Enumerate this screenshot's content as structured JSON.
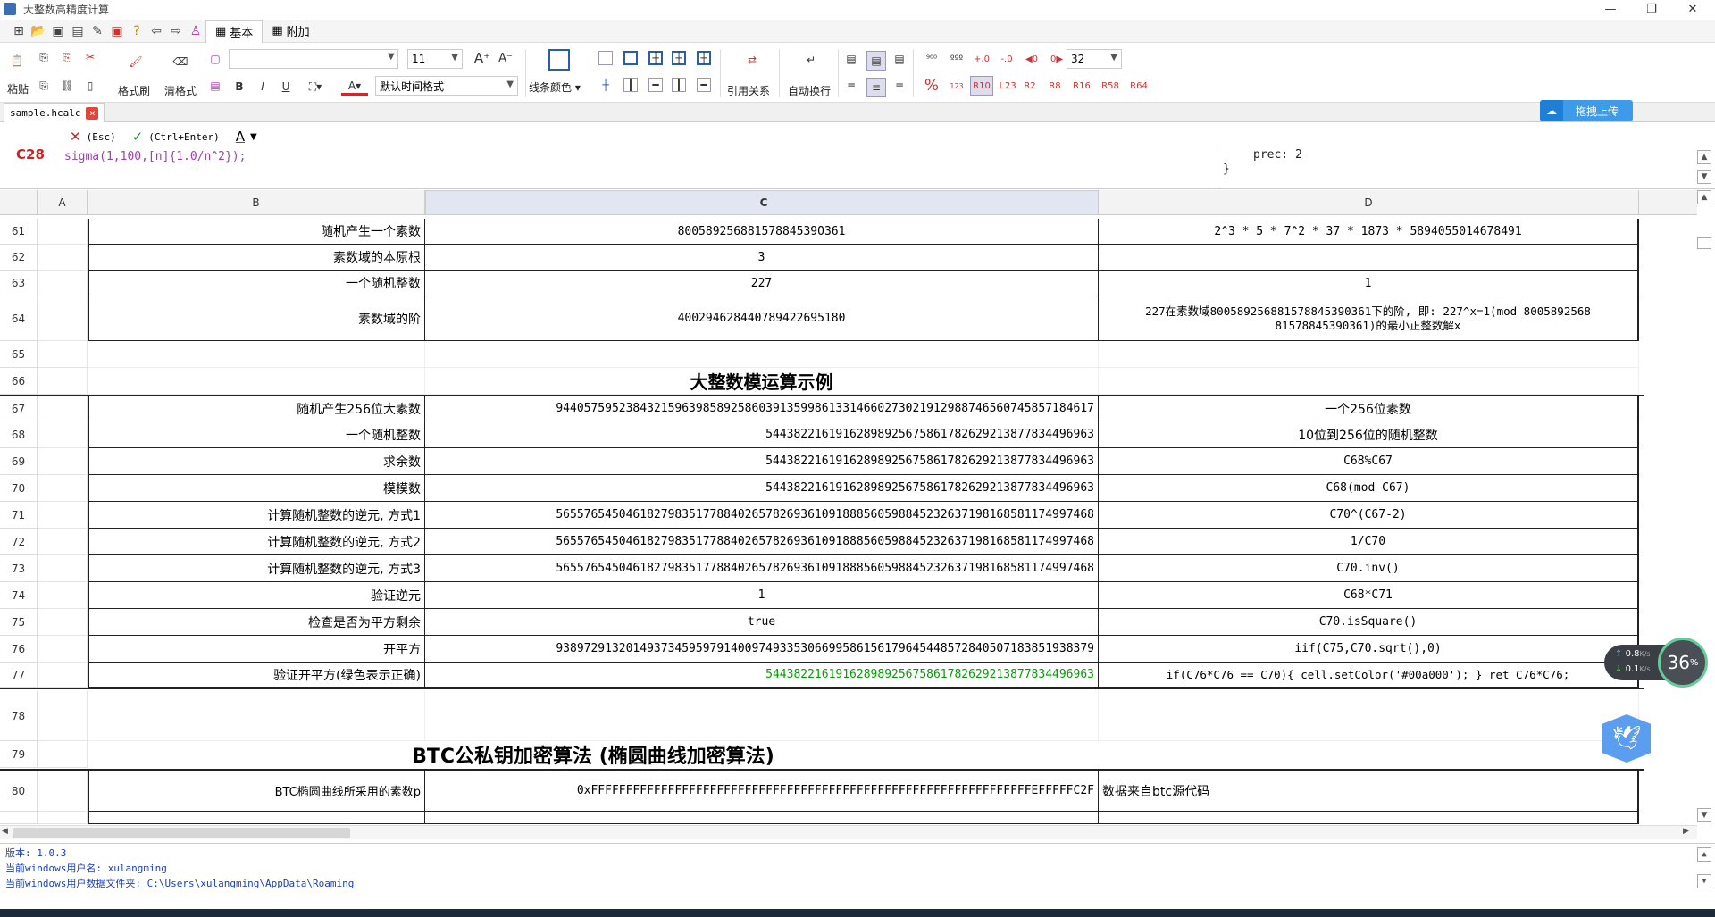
{
  "window": {
    "title": "大整数高精度计算",
    "min": "—",
    "max": "❐",
    "close": "✕"
  },
  "tabs": [
    {
      "label": "基本"
    },
    {
      "label": "附加"
    }
  ],
  "ribbon": {
    "paste": "粘贴",
    "format_painter": "格式刷",
    "clear_format": "清格式",
    "font_size": "11",
    "font_name": "",
    "time_format": "默认时间格式",
    "line_color": "线条颜色",
    "ref_relation": "引用关系",
    "auto_wrap": "自动换行",
    "precision": "32",
    "bold": "B",
    "italic": "I",
    "underline": "U",
    "font_color_letter": "A",
    "percent": "%",
    "r10": "R10",
    "r2": "R2",
    "r8": "R8",
    "r16": "R16",
    "r58": "R58",
    "r64": "R64"
  },
  "file_tab": {
    "name": "sample.hcalc",
    "close": "×"
  },
  "upload_label": "拖拽上传",
  "formula": {
    "cell_ref": "C28",
    "cancel": "(Esc)",
    "confirm": "(Ctrl+Enter)",
    "text": "sigma(1,100,[n]{1.0/n^2});",
    "options_line1": "prec: 2",
    "options_line2": "}"
  },
  "columns": [
    "A",
    "B",
    "C",
    "D"
  ],
  "rows": [
    {
      "n": "61",
      "b": "随机产生一个素数",
      "c": "80058925688157884539O361",
      "d": "2^3 * 5 * 7^2 * 37 * 1873 * 5894055014678491"
    },
    {
      "n": "62",
      "b": "素数域的本原根",
      "c": "3",
      "d": ""
    },
    {
      "n": "63",
      "b": "一个随机整数",
      "c": "227",
      "d": "1"
    },
    {
      "n": "64",
      "b": "素数域的阶",
      "c": "400294628440789422695180",
      "d1": "227在素数域800589256881578845390361下的阶, 即: 227^x=1(mod 8005892568",
      "d2": "81578845390361)的最小正整数解x"
    },
    {
      "n": "65"
    },
    {
      "n": "66",
      "title": "大整数模运算示例"
    },
    {
      "n": "67",
      "b": "随机产生256位大素数",
      "c": "94405759523843215963985892586039135998613314660273021912988746560745857184617",
      "d": "一个256位素数"
    },
    {
      "n": "68",
      "b": "一个随机整数",
      "c": "54438221619162898925675861782629213877834496963",
      "d": "10位到256位的随机整数"
    },
    {
      "n": "69",
      "b": "求余数",
      "c": "54438221619162898925675861782629213877834496963",
      "d": "C68%C67"
    },
    {
      "n": "70",
      "b": "模模数",
      "c": "54438221619162898925675861782629213877834496963",
      "d": "C68(mod C67)"
    },
    {
      "n": "71",
      "b": "计算随机整数的逆元, 方式1",
      "c": "56557654504618279835177884026578269361091888560598845232637198168581174997468",
      "d": "C70^(C67-2)"
    },
    {
      "n": "72",
      "b": "计算随机整数的逆元, 方式2",
      "c": "56557654504618279835177884026578269361091888560598845232637198168581174997468",
      "d": "1/C70"
    },
    {
      "n": "73",
      "b": "计算随机整数的逆元, 方式3",
      "c": "56557654504618279835177884026578269361091888560598845232637198168581174997468",
      "d": "C70.inv()"
    },
    {
      "n": "74",
      "b": "验证逆元",
      "c": "1",
      "d": "C68*C71"
    },
    {
      "n": "75",
      "b": "检查是否为平方剩余",
      "c": "true",
      "d": "C70.isSquare()"
    },
    {
      "n": "76",
      "b": "开平方",
      "c": "93897291320149373459597914009749335306699586156179645448572840507183851938379",
      "d": "iif(C75,C70.sqrt(),0)"
    },
    {
      "n": "77",
      "b": "验证开平方(绿色表示正确)",
      "c": "54438221619162898925675861782629213877834496963",
      "d": "if(C76*C76 == C70){  cell.setColor('#00a000'); } ret C76*C76;"
    },
    {
      "n": "78"
    },
    {
      "n": "79",
      "title": "BTC公私钥加密算法 (椭圆曲线加密算法)"
    },
    {
      "n": "80",
      "b": "BTC椭圆曲线所采用的素数p",
      "c": "0xFFFFFFFFFFFFFFFFFFFFFFFFFFFFFFFFFFFFFFFFFFFFFFFFFFFFFFFFFFFFFFFEFFFFFC2F",
      "d": "数据来自btc源代码"
    }
  ],
  "green_color": "#00a000",
  "net": {
    "up": "0.8",
    "down": "0.1",
    "unit": "K/s",
    "percent": "36",
    "pct_sign": "%"
  },
  "log": {
    "line1": "版本: 1.0.3",
    "line2": "当前windows用户名: xulangming",
    "line3": "当前windows用户数据文件夹: C:\\Users\\xulangming\\AppData\\Roaming"
  }
}
